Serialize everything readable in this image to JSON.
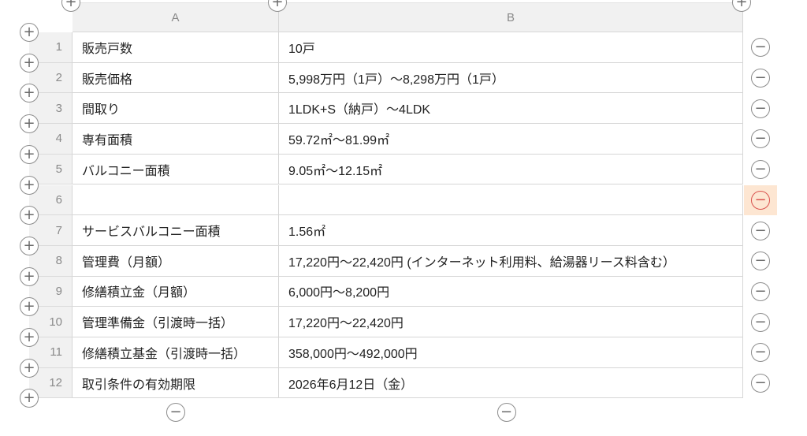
{
  "columns": [
    {
      "label": "A"
    },
    {
      "label": "B"
    }
  ],
  "rows": [
    {
      "num": "1",
      "a": "販売戸数",
      "b": "10戸"
    },
    {
      "num": "2",
      "a": "販売価格",
      "b": "5,998万円（1戸）～8,298万円（1戸）"
    },
    {
      "num": "3",
      "a": "間取り",
      "b": "1LDK+S（納戸）～4LDK"
    },
    {
      "num": "4",
      "a": "専有面積",
      "b": "59.72㎡～81.99㎡"
    },
    {
      "num": "5",
      "a": "バルコニー面積",
      "b": "9.05㎡～12.15㎡"
    },
    {
      "num": "6",
      "a": "",
      "b": ""
    },
    {
      "num": "7",
      "a": "サービスバルコニー面積",
      "b": "1.56㎡"
    },
    {
      "num": "8",
      "a": "管理費（月額）",
      "b": "17,220円～22,420円 (インターネット利用料、給湯器リース料含む）"
    },
    {
      "num": "9",
      "a": "修繕積立金（月額）",
      "b": "6,000円～8,200円"
    },
    {
      "num": "10",
      "a": "管理準備金（引渡時一括）",
      "b": "17,220円～22,420円"
    },
    {
      "num": "11",
      "a": "修繕積立基金（引渡時一括）",
      "b": "358,000円～492,000円"
    },
    {
      "num": "12",
      "a": "取引条件の有効期限",
      "b": "2026年6月12日（金）"
    }
  ],
  "controls": {
    "add_symbol": "+",
    "remove_symbol": "−",
    "active_remove_row": 6
  },
  "colors": {
    "header_bg": "#f1f1f1",
    "highlight_bg": "#fde6d2",
    "highlight_icon": "#d9534f"
  }
}
